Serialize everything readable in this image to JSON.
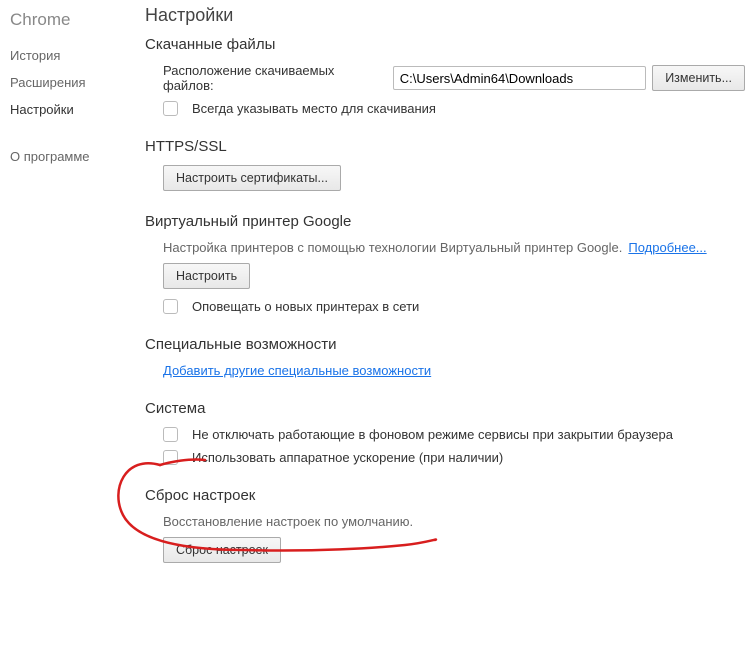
{
  "sidebar": {
    "title": "Chrome",
    "items": [
      {
        "label": "История"
      },
      {
        "label": "Расширения"
      },
      {
        "label": "Настройки"
      },
      {
        "label": "О программе"
      }
    ]
  },
  "page": {
    "title": "Настройки"
  },
  "downloads": {
    "heading": "Скачанные файлы",
    "location_label": "Расположение скачиваемых файлов:",
    "location_value": "C:\\Users\\Admin64\\Downloads",
    "change_btn": "Изменить...",
    "ask_each_time": "Всегда указывать место для скачивания"
  },
  "https_ssl": {
    "heading": "HTTPS/SSL",
    "configure_btn": "Настроить сертификаты..."
  },
  "cloud_print": {
    "heading": "Виртуальный принтер Google",
    "description": "Настройка принтеров с помощью технологии Виртуальный принтер Google. ",
    "learn_more": "Подробнее...",
    "configure_btn": "Настроить",
    "notify_new_printers": "Оповещать о новых принтерах в сети"
  },
  "accessibility": {
    "heading": "Специальные возможности",
    "add_link": "Добавить другие специальные возможности"
  },
  "system": {
    "heading": "Система",
    "keep_background": "Не отключать работающие в фоновом режиме сервисы при закрытии браузера",
    "hw_acceleration": "Использовать аппаратное ускорение (при наличии)"
  },
  "reset": {
    "heading": "Сброс настроек",
    "description": "Восстановление настроек по умолчанию.",
    "reset_btn": "Сброс настроек"
  }
}
